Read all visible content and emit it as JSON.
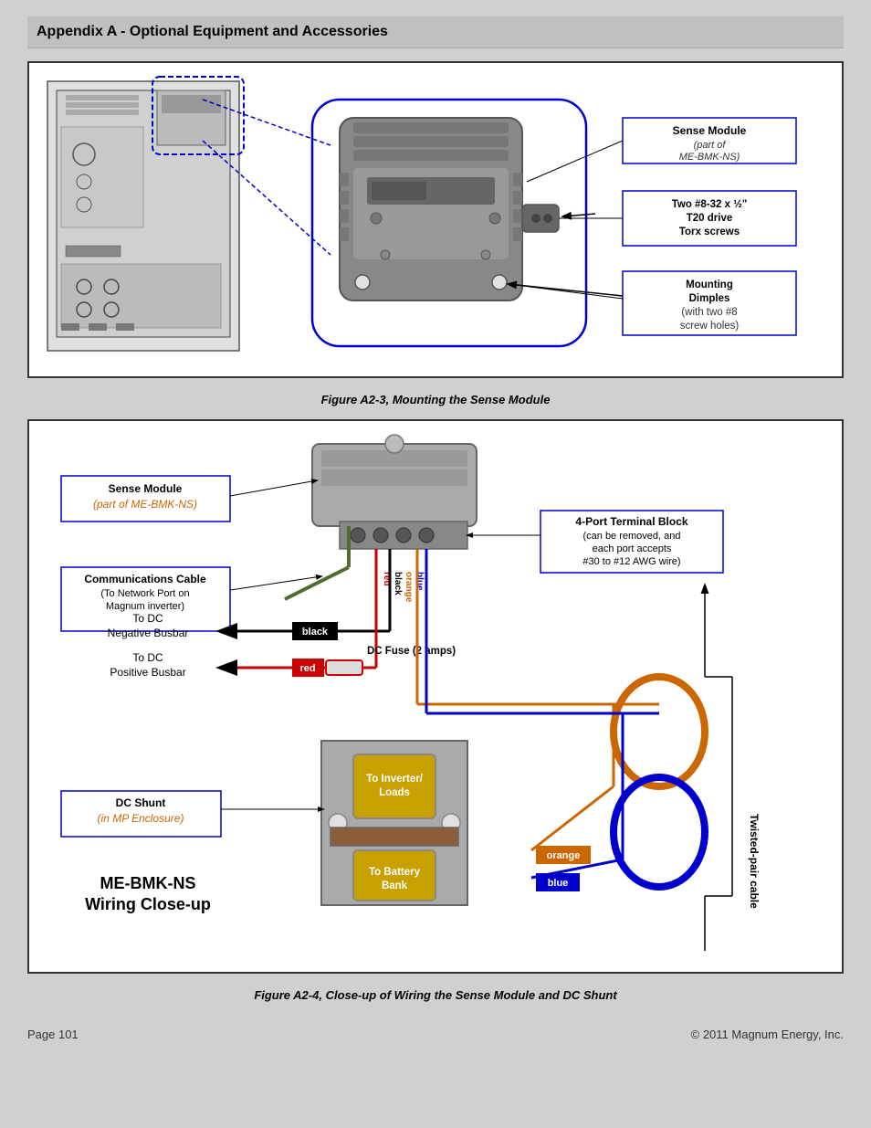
{
  "header": {
    "title": "Appendix A - Optional Equipment and Accessories"
  },
  "figure1": {
    "caption": "Figure A2-3, Mounting the Sense Module",
    "labels": {
      "sense_module": "Sense Module",
      "sense_module_sub": "(part of ME-BMK-NS)",
      "screws": "Two #8-32 x ½\"",
      "screws2": "T20 drive",
      "screws3": "Torx screws",
      "dimples": "Mounting",
      "dimples2": "Dimples",
      "dimples3": "(with two #8",
      "dimples4": "screw holes)"
    }
  },
  "figure2": {
    "caption": "Figure A2-4, Close-up of Wiring the Sense Module and DC Shunt",
    "labels": {
      "sense_module": "Sense Module",
      "sense_module_sub": "(part of ME-BMK-NS)",
      "comm_cable": "Communications Cable",
      "comm_cable_sub": "(To Network Port on",
      "comm_cable_sub2": "Magnum inverter)",
      "terminal_block": "4-Port Terminal Block",
      "terminal_block_sub": "(can be removed, and",
      "terminal_block_sub2": "each port accepts",
      "terminal_block_sub3": "#30 to #12 AWG wire)",
      "to_dc_neg": "To DC",
      "to_dc_neg2": "Negative Busbar",
      "black_label": "black",
      "to_dc_pos": "To DC",
      "to_dc_pos2": "Positive Busbar",
      "red_label": "red",
      "dc_fuse": "DC Fuse (2 amps)",
      "to_inverter": "To Inverter/",
      "to_inverter2": "Loads",
      "dc_shunt": "DC Shunt",
      "dc_shunt_sub": "(in MP Enclosure)",
      "to_battery": "To Battery",
      "to_battery2": "Bank",
      "orange_label": "orange",
      "blue_label": "blue",
      "twisted_pair": "Twisted-pair cable",
      "title": "ME-BMK-NS",
      "title2": "Wiring Close-up",
      "wire_blue": "blue",
      "wire_orange": "orange",
      "wire_red": "red",
      "wire_black": "black"
    }
  },
  "footer": {
    "page": "Page 101",
    "copyright": "© 2011 Magnum Energy, Inc."
  }
}
